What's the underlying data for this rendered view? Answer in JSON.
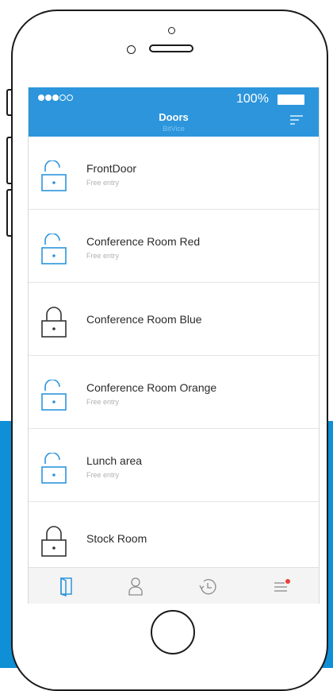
{
  "status_bar": {
    "battery_text": "100%",
    "signal_bars": 5,
    "signal_filled": 3
  },
  "header": {
    "title": "Doors",
    "subtitle": "BitVice",
    "filter_icon": "filter-icon"
  },
  "doors": [
    {
      "name": "FrontDoor",
      "status": "Free entry",
      "lock": "unlocked"
    },
    {
      "name": "Conference Room Red",
      "status": "Free entry",
      "lock": "unlocked"
    },
    {
      "name": "Conference Room Blue",
      "status": "",
      "lock": "locked"
    },
    {
      "name": "Conference Room Orange",
      "status": "Free entry",
      "lock": "unlocked"
    },
    {
      "name": "Lunch area",
      "status": "Free entry",
      "lock": "unlocked"
    },
    {
      "name": "Stock Room",
      "status": "",
      "lock": "locked"
    }
  ],
  "tabs": [
    {
      "icon": "door-icon",
      "active": true
    },
    {
      "icon": "user-icon",
      "active": false
    },
    {
      "icon": "history-icon",
      "active": false
    },
    {
      "icon": "menu-icon",
      "active": false,
      "badge": true
    }
  ],
  "colors": {
    "accent": "#2c95dc",
    "backdrop": "#0f8fd6",
    "badge": "#e8403a",
    "locked": "#333333"
  }
}
